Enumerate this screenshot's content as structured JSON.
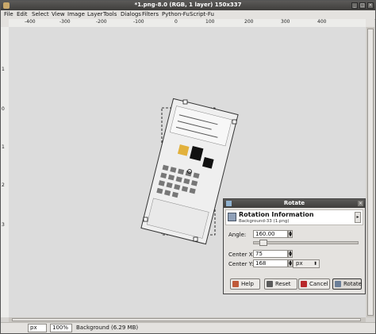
{
  "window": {
    "title": "*1.png-8.0 (RGB, 1 layer) 150x337"
  },
  "menu": [
    "File",
    "Edit",
    "Select",
    "View",
    "Image",
    "Layer",
    "Tools",
    "Dialogs",
    "Filters",
    "Python-Fu",
    "Script-Fu"
  ],
  "ruler": {
    "h_labels": [
      "-400",
      "-300",
      "-200",
      "-100",
      "0",
      "100",
      "200",
      "300",
      "400"
    ],
    "v_labels": [
      "1",
      "0",
      "1",
      "2",
      "3"
    ]
  },
  "statusbar": {
    "coords": "",
    "unit": "px",
    "zoom": "100%",
    "message": "Background (6.29 MB)"
  },
  "dialog": {
    "title": "Rotate",
    "header_title": "Rotation Information",
    "header_sub": "Background-33 (1.png)",
    "angle_label": "Angle:",
    "angle_value": "160.00",
    "center_x_label": "Center X:",
    "center_x_value": "75",
    "center_y_label": "Center Y:",
    "center_y_value": "168",
    "unit_value": "px",
    "buttons": {
      "help": "Help",
      "reset": "Reset",
      "cancel": "Cancel",
      "rotate": "Rotate"
    }
  }
}
